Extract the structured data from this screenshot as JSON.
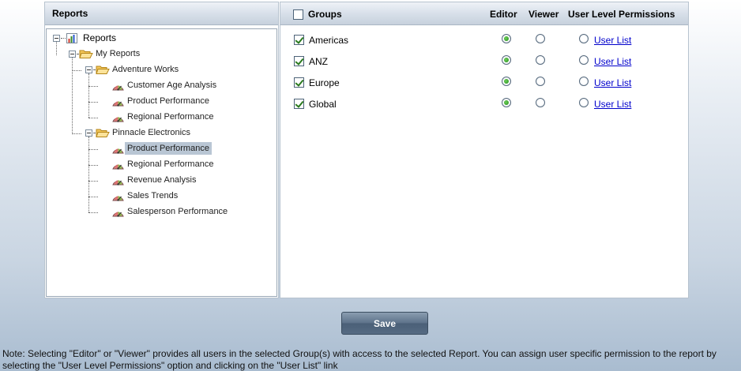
{
  "left_panel": {
    "title": "Reports",
    "tree": {
      "root": "Reports",
      "my_reports": "My Reports",
      "folders": [
        {
          "name": "Adventure Works",
          "reports": [
            "Customer Age Analysis",
            "Product Performance",
            "Regional Performance"
          ]
        },
        {
          "name": "Pinnacle Electronics",
          "reports": [
            "Product Performance",
            "Regional Performance",
            "Revenue Analysis",
            "Sales Trends",
            "Salesperson Performance"
          ]
        }
      ],
      "selected": "Pinnacle Electronics / Product Performance"
    }
  },
  "right_panel": {
    "header": {
      "groups_label": "Groups",
      "groups_checked": false,
      "editor_label": "Editor",
      "viewer_label": "Viewer",
      "user_level_label": "User Level Permissions"
    },
    "groups": [
      {
        "name": "Americas",
        "checked": true,
        "permission": "Editor",
        "link": "User List"
      },
      {
        "name": "ANZ",
        "checked": true,
        "permission": "Editor",
        "link": "User List"
      },
      {
        "name": "Europe",
        "checked": true,
        "permission": "Editor",
        "link": "User List"
      },
      {
        "name": "Global",
        "checked": true,
        "permission": "Editor",
        "link": "User List"
      }
    ]
  },
  "actions": {
    "save_label": "Save"
  },
  "note": "Note: Selecting \"Editor\" or \"Viewer\" provides all users in the selected Group(s) with access to the selected Report. You can assign user specific permission to the report by selecting the \"User Level Permissions\" option and clicking on the \"User List\" link",
  "colors": {
    "link": "#0000cc",
    "selected_highlight": "#b9c6d4",
    "save_button": "#566b83",
    "radio_checked": "#1f8a16"
  }
}
